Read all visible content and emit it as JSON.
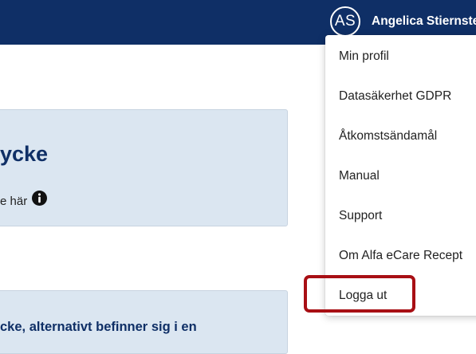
{
  "header": {
    "avatar_initials": "AS",
    "user_name": "Angelica Stiernstedt"
  },
  "main": {
    "card_1_title": "ycke",
    "card_1_text": "e här",
    "card_2_text": "cke, alternativt befinner sig i en"
  },
  "user_menu": {
    "items": [
      "Min profil",
      "Datasäkerhet GDPR",
      "Åtkomstsändamål",
      "Manual",
      "Support",
      "Om Alfa eCare Recept",
      "Logga ut"
    ]
  },
  "colors": {
    "header_bg": "#0f2f66",
    "card_bg": "#dbe6f1",
    "highlight": "#a80f14"
  },
  "icons": [
    "info-icon"
  ]
}
